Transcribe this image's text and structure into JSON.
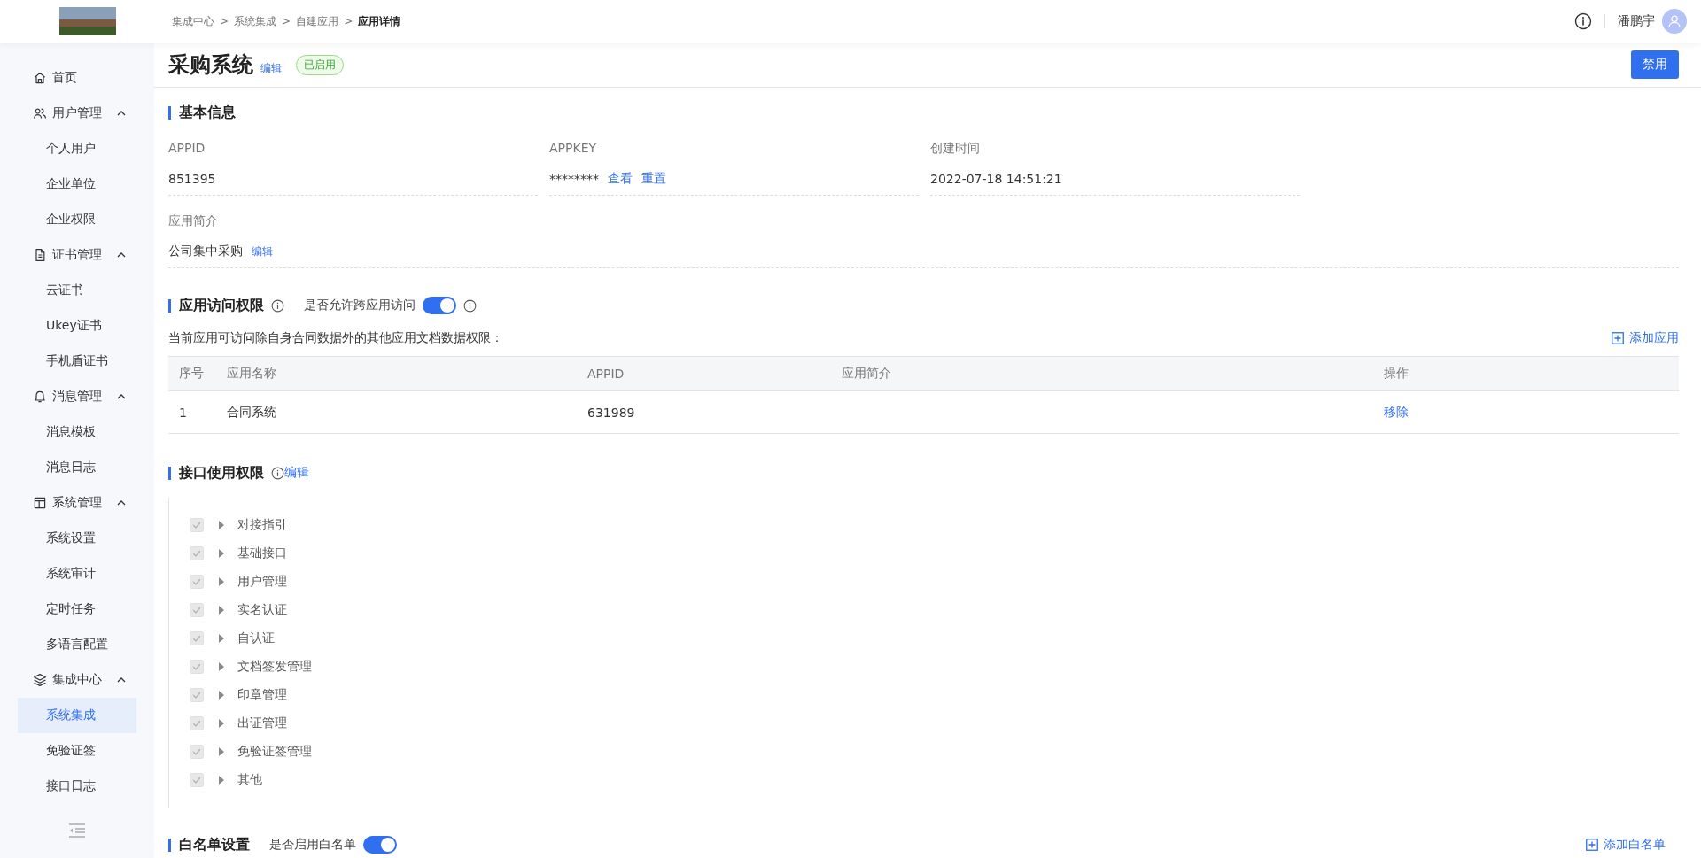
{
  "header": {
    "breadcrumb": [
      {
        "label": "集成中心",
        "current": false
      },
      {
        "label": "系统集成",
        "current": false
      },
      {
        "label": "自建应用",
        "current": false
      },
      {
        "label": "应用详情",
        "current": true
      }
    ],
    "separator": ">",
    "user_name": "潘鹏宇"
  },
  "sidebar": {
    "items": [
      {
        "label": "首页",
        "selected": false
      },
      {
        "label": "用户管理",
        "expanded": true,
        "selected": false,
        "children": [
          {
            "label": "个人用户",
            "selected": false
          },
          {
            "label": "企业单位",
            "selected": false
          },
          {
            "label": "企业权限",
            "selected": false
          }
        ]
      },
      {
        "label": "证书管理",
        "expanded": true,
        "selected": false,
        "children": [
          {
            "label": "云证书",
            "selected": false
          },
          {
            "label": "Ukey证书",
            "selected": false
          },
          {
            "label": "手机盾证书",
            "selected": false
          }
        ]
      },
      {
        "label": "消息管理",
        "expanded": true,
        "selected": false,
        "children": [
          {
            "label": "消息模板",
            "selected": false
          },
          {
            "label": "消息日志",
            "selected": false
          }
        ]
      },
      {
        "label": "系统管理",
        "expanded": true,
        "selected": false,
        "children": [
          {
            "label": "系统设置",
            "selected": false
          },
          {
            "label": "系统审计",
            "selected": false
          },
          {
            "label": "定时任务",
            "selected": false
          },
          {
            "label": "多语言配置",
            "selected": false
          }
        ]
      },
      {
        "label": "集成中心",
        "expanded": true,
        "selected": false,
        "children": [
          {
            "label": "系统集成",
            "selected": true
          },
          {
            "label": "免验证签",
            "selected": false
          },
          {
            "label": "接口日志",
            "selected": false
          }
        ]
      }
    ]
  },
  "page": {
    "title": "采购系统",
    "edit": "编辑",
    "status": "已启用",
    "enabled": true,
    "disable_button": "禁用"
  },
  "basic_info": {
    "title": "基本信息",
    "fields": [
      {
        "label": "APPID",
        "value": "851395"
      },
      {
        "label": "APPKEY",
        "value": "********",
        "actions": [
          "查看",
          "重置"
        ]
      },
      {
        "label": "创建时间",
        "value": "2022-07-18 14:51:21"
      }
    ],
    "intro": {
      "label": "应用简介",
      "value": "公司集中采购",
      "edit": "编辑"
    }
  },
  "access": {
    "title": "应用访问权限",
    "toggle_label": "是否允许跨应用访问",
    "on": true,
    "description": "当前应用可访问除自身合同数据外的其他应用文档数据权限：",
    "add_button": "添加应用",
    "table": {
      "columns": [
        "序号",
        "应用名称",
        "APPID",
        "应用简介",
        "操作"
      ],
      "rows": [
        {
          "index": "1",
          "name": "合同系统",
          "appid": "631989",
          "action": "移除"
        }
      ]
    }
  },
  "api": {
    "title": "接口使用权限",
    "edit": "编辑",
    "items": [
      {
        "label": "对接指引",
        "checked": true,
        "disabled": true,
        "expanded": false
      },
      {
        "label": "基础接口",
        "checked": true,
        "disabled": true,
        "expanded": false
      },
      {
        "label": "用户管理",
        "checked": true,
        "disabled": true,
        "expanded": false
      },
      {
        "label": "实名认证",
        "checked": true,
        "disabled": true,
        "expanded": false
      },
      {
        "label": "自认证",
        "checked": true,
        "disabled": true,
        "expanded": false
      },
      {
        "label": "文档签发管理",
        "checked": true,
        "disabled": true,
        "expanded": false
      },
      {
        "label": "印章管理",
        "checked": true,
        "disabled": true,
        "expanded": false
      },
      {
        "label": "出证管理",
        "checked": true,
        "disabled": true,
        "expanded": false
      },
      {
        "label": "免验证签管理",
        "checked": true,
        "disabled": true,
        "expanded": false
      },
      {
        "label": "其他",
        "checked": true,
        "disabled": true,
        "expanded": false
      }
    ]
  },
  "whitelist": {
    "title": "白名单设置",
    "toggle_label": "是否启用白名单",
    "on": true,
    "add_button": "添加白名单"
  }
}
